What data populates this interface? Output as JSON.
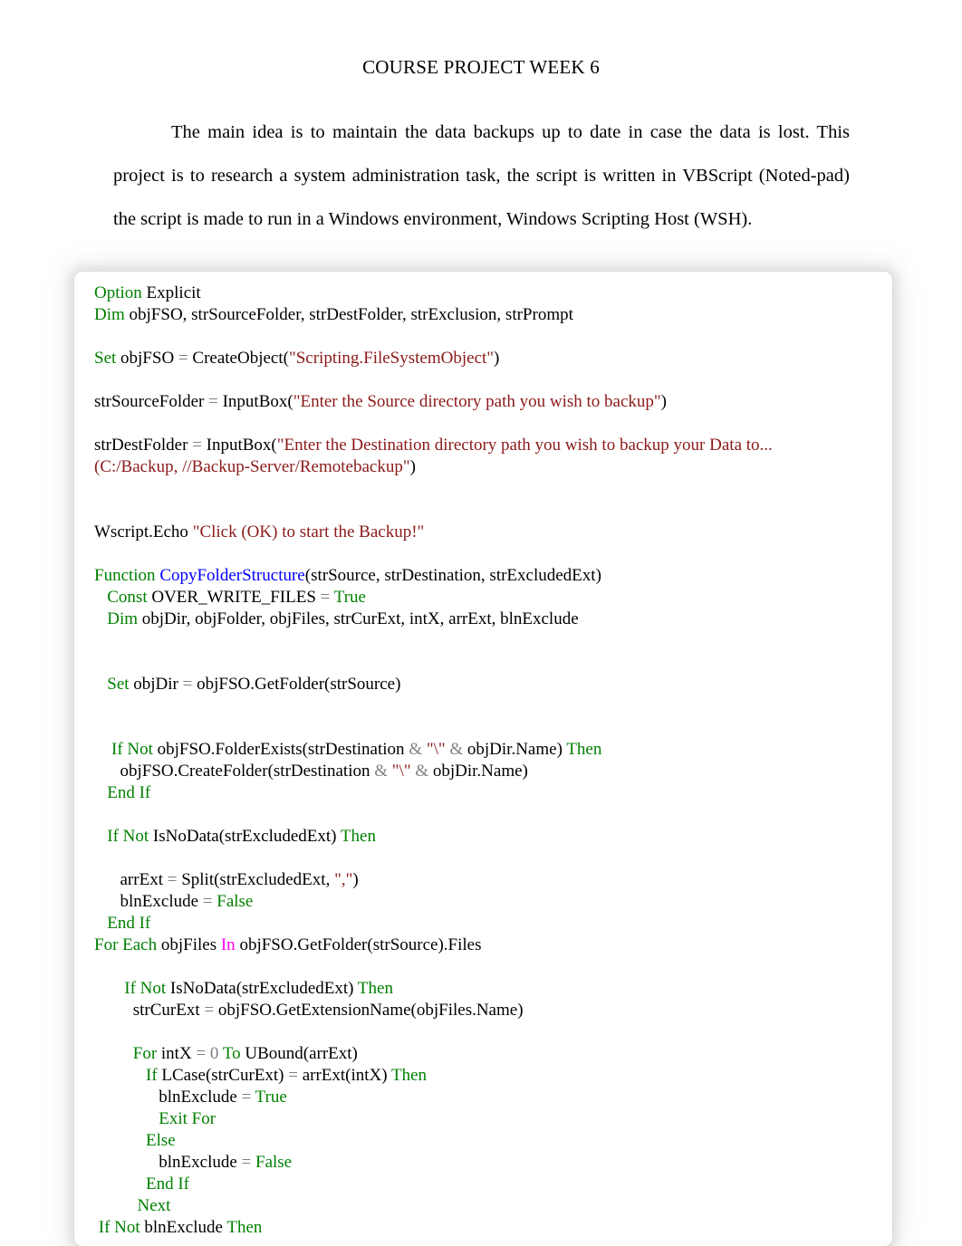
{
  "document": {
    "title": "COURSE PROJECT WEEK 6",
    "intro_paragraph": "The main idea is to maintain the data backups up to date in case the data is lost. This project is to  research a system administration task, the script is written in VBScript (Noted-pad) the script is made to run in a Windows environment, Windows Scripting Host (WSH)."
  },
  "colors": {
    "keyword_green": "#008000",
    "string_dark_red": "#8B1A1A",
    "function_blue": "#0000FF",
    "operator_gray": "#808080",
    "magenta": "#FF00FF",
    "identifier_black": "#000000",
    "page_background": "#FFFFFF",
    "panel_background": "#FFFFFF"
  },
  "code_block": {
    "language": "VBScript",
    "lines": [
      [
        {
          "t": "Option",
          "c": "kw"
        },
        {
          "t": " Explicit",
          "c": "id"
        }
      ],
      [
        {
          "t": "Dim",
          "c": "kw"
        },
        {
          "t": " objFSO, strSourceFolder, strDestFolder, strExclusion, strPrompt",
          "c": "id"
        }
      ],
      [],
      [
        {
          "t": "Set",
          "c": "kw"
        },
        {
          "t": " objFSO ",
          "c": "id"
        },
        {
          "t": "=",
          "c": "op"
        },
        {
          "t": " CreateObject(",
          "c": "id"
        },
        {
          "t": "\"Scripting.FileSystemObject\"",
          "c": "str"
        },
        {
          "t": ")",
          "c": "id"
        }
      ],
      [],
      [
        {
          "t": "strSourceFolder ",
          "c": "id"
        },
        {
          "t": "=",
          "c": "op"
        },
        {
          "t": " InputBox(",
          "c": "id"
        },
        {
          "t": "\"Enter the Source directory path you wish to backup\"",
          "c": "str"
        },
        {
          "t": ")",
          "c": "id"
        }
      ],
      [],
      [
        {
          "t": "strDestFolder ",
          "c": "id"
        },
        {
          "t": "=",
          "c": "op"
        },
        {
          "t": " InputBox(",
          "c": "id"
        },
        {
          "t": "\"Enter the Destination directory path you wish to backup your Data to...",
          "c": "str"
        }
      ],
      [
        {
          "t": "(C:/Backup, //Backup-Server/Remotebackup\"",
          "c": "str"
        },
        {
          "t": ")",
          "c": "id"
        }
      ],
      [],
      [],
      [
        {
          "t": "Wscript.Echo ",
          "c": "id"
        },
        {
          "t": "\"Click (OK) to start the Backup!\"",
          "c": "str"
        }
      ],
      [],
      [
        {
          "t": "Function ",
          "c": "kw"
        },
        {
          "t": "CopyFolderStructure",
          "c": "fn"
        },
        {
          "t": "(strSource, strDestination, strExcludedExt)",
          "c": "id"
        }
      ],
      [
        {
          "t": "   ",
          "c": "id"
        },
        {
          "t": "Const",
          "c": "kw"
        },
        {
          "t": " OVER_WRITE_FILES ",
          "c": "id"
        },
        {
          "t": "=",
          "c": "op"
        },
        {
          "t": " True",
          "c": "kw"
        }
      ],
      [
        {
          "t": "   ",
          "c": "id"
        },
        {
          "t": "Dim",
          "c": "kw"
        },
        {
          "t": " objDir, objFolder, objFiles, strCurExt, intX, arrExt, blnExclude",
          "c": "id"
        }
      ],
      [],
      [],
      [
        {
          "t": "   ",
          "c": "id"
        },
        {
          "t": "Set",
          "c": "kw"
        },
        {
          "t": " objDir ",
          "c": "id"
        },
        {
          "t": "=",
          "c": "op"
        },
        {
          "t": " objFSO.GetFolder(strSource)",
          "c": "id"
        }
      ],
      [],
      [],
      [
        {
          "t": "    ",
          "c": "id"
        },
        {
          "t": "If Not",
          "c": "kw"
        },
        {
          "t": " objFSO.FolderExists(strDestination ",
          "c": "id"
        },
        {
          "t": "&",
          "c": "op"
        },
        {
          "t": " \"\\\"",
          "c": "str"
        },
        {
          "t": " &",
          "c": "op"
        },
        {
          "t": " objDir.Name) ",
          "c": "id"
        },
        {
          "t": "Then",
          "c": "kw"
        }
      ],
      [
        {
          "t": "      objFSO.CreateFolder(strDestination ",
          "c": "id"
        },
        {
          "t": "&",
          "c": "op"
        },
        {
          "t": " \"\\\"",
          "c": "str"
        },
        {
          "t": " &",
          "c": "op"
        },
        {
          "t": " objDir.Name)",
          "c": "id"
        }
      ],
      [
        {
          "t": "   ",
          "c": "id"
        },
        {
          "t": "End If",
          "c": "kw"
        }
      ],
      [],
      [
        {
          "t": "   ",
          "c": "id"
        },
        {
          "t": "If Not",
          "c": "kw"
        },
        {
          "t": " IsNoData(strExcludedExt) ",
          "c": "id"
        },
        {
          "t": "Then",
          "c": "kw"
        }
      ],
      [],
      [
        {
          "t": "      arrExt ",
          "c": "id"
        },
        {
          "t": "=",
          "c": "op"
        },
        {
          "t": " Split(strExcludedExt, ",
          "c": "id"
        },
        {
          "t": "\",\"",
          "c": "str"
        },
        {
          "t": ")",
          "c": "id"
        }
      ],
      [
        {
          "t": "      blnExclude ",
          "c": "id"
        },
        {
          "t": "=",
          "c": "op"
        },
        {
          "t": " False",
          "c": "kw"
        }
      ],
      [
        {
          "t": "   ",
          "c": "id"
        },
        {
          "t": "End If",
          "c": "kw"
        }
      ],
      [
        {
          "t": "For Each",
          "c": "kw"
        },
        {
          "t": " objFiles ",
          "c": "id"
        },
        {
          "t": "In",
          "c": "mag"
        },
        {
          "t": " objFSO.GetFolder(strSource).Files",
          "c": "id"
        }
      ],
      [],
      [
        {
          "t": "       ",
          "c": "id"
        },
        {
          "t": "If Not",
          "c": "kw"
        },
        {
          "t": " IsNoData(strExcludedExt) ",
          "c": "id"
        },
        {
          "t": "Then",
          "c": "kw"
        }
      ],
      [
        {
          "t": "         strCurExt ",
          "c": "id"
        },
        {
          "t": "=",
          "c": "op"
        },
        {
          "t": " objFSO.GetExtensionName(objFiles.Name)",
          "c": "id"
        }
      ],
      [],
      [
        {
          "t": "         ",
          "c": "id"
        },
        {
          "t": "For",
          "c": "kw"
        },
        {
          "t": " intX ",
          "c": "id"
        },
        {
          "t": "=",
          "c": "op"
        },
        {
          "t": " ",
          "c": "id"
        },
        {
          "t": "0",
          "c": "num"
        },
        {
          "t": " To",
          "c": "kw"
        },
        {
          "t": " UBound(arrExt)",
          "c": "id"
        }
      ],
      [
        {
          "t": "            ",
          "c": "id"
        },
        {
          "t": "If",
          "c": "kw"
        },
        {
          "t": " LCase(strCurExt) ",
          "c": "id"
        },
        {
          "t": "=",
          "c": "op"
        },
        {
          "t": " arrExt(intX) ",
          "c": "id"
        },
        {
          "t": "Then",
          "c": "kw"
        }
      ],
      [
        {
          "t": "               blnExclude ",
          "c": "id"
        },
        {
          "t": "=",
          "c": "op"
        },
        {
          "t": " True",
          "c": "kw"
        }
      ],
      [
        {
          "t": "               ",
          "c": "id"
        },
        {
          "t": "Exit For",
          "c": "kw"
        }
      ],
      [
        {
          "t": "            ",
          "c": "id"
        },
        {
          "t": "Else",
          "c": "kw"
        }
      ],
      [
        {
          "t": "               blnExclude ",
          "c": "id"
        },
        {
          "t": "=",
          "c": "op"
        },
        {
          "t": " False",
          "c": "kw"
        }
      ],
      [
        {
          "t": "            ",
          "c": "id"
        },
        {
          "t": "End If",
          "c": "kw"
        }
      ],
      [
        {
          "t": "          ",
          "c": "id"
        },
        {
          "t": "Next",
          "c": "kw"
        }
      ],
      [
        {
          "t": " ",
          "c": "id"
        },
        {
          "t": "If Not",
          "c": "kw"
        },
        {
          "t": " blnExclude ",
          "c": "id"
        },
        {
          "t": "Then",
          "c": "kw"
        }
      ]
    ]
  }
}
